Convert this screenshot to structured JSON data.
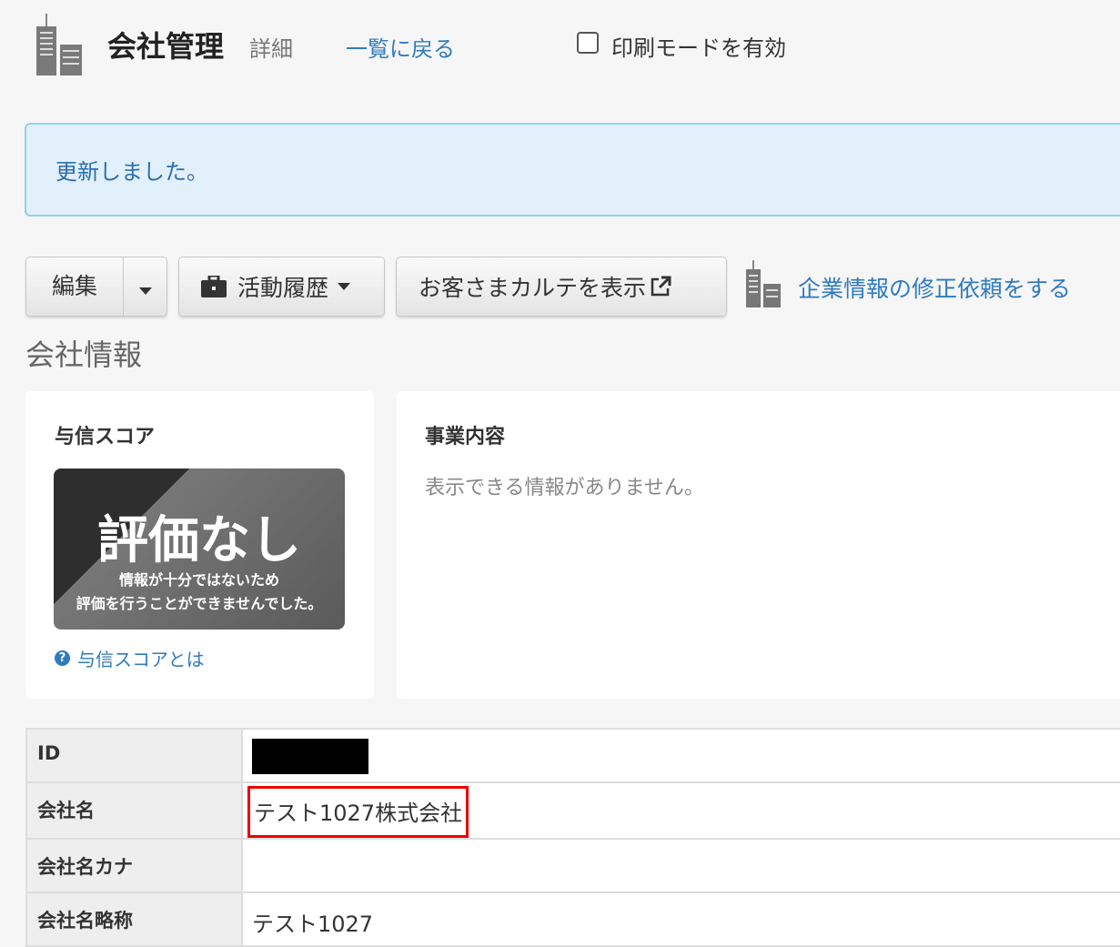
{
  "header": {
    "title": "会社管理",
    "subtitle": "詳細",
    "back_link": "一覧に戻る",
    "print_mode_label": "印刷モードを有効",
    "print_mode_checked": false
  },
  "alert": {
    "message": "更新しました。"
  },
  "toolbar": {
    "edit_label": "編集",
    "activity_label": "活動履歴",
    "karte_label": "お客さまカルテを表示",
    "correction_link": "企業情報の修正依頼をする"
  },
  "section_title": "会社情報",
  "credit": {
    "title": "与信スコア",
    "rating": "評価なし",
    "note_line1": "情報が十分ではないため",
    "note_line2": "評価を行うことができませんでした。",
    "help_link": "与信スコアとは"
  },
  "business": {
    "title": "事業内容",
    "empty_text": "表示できる情報がありません。"
  },
  "table": {
    "rows": [
      {
        "label": "ID",
        "value": ""
      },
      {
        "label": "会社名",
        "value": "テスト1027株式会社"
      },
      {
        "label": "会社名カナ",
        "value": ""
      },
      {
        "label": "会社名略称",
        "value": "テスト1027"
      }
    ]
  }
}
